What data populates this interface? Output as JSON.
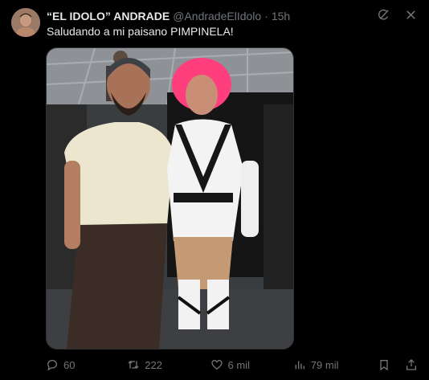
{
  "author": {
    "display_name": "“EL IDOLO” ANDRADE",
    "handle": "@AndradeElIdolo",
    "separator": "·",
    "time": "15h",
    "avatar_icon": "profile-avatar"
  },
  "post": {
    "text": "Saludando a mi paisano PIMPINELA!"
  },
  "top_icons": [
    "grok-icon",
    "more-icon"
  ],
  "actions": {
    "replies": "60",
    "reposts": "222",
    "likes": "6 mil",
    "views": "79 mil"
  },
  "colors": {
    "background": "#000000",
    "text_primary": "#e7e9ea",
    "text_secondary": "#71767b",
    "border": "#2f3336"
  }
}
